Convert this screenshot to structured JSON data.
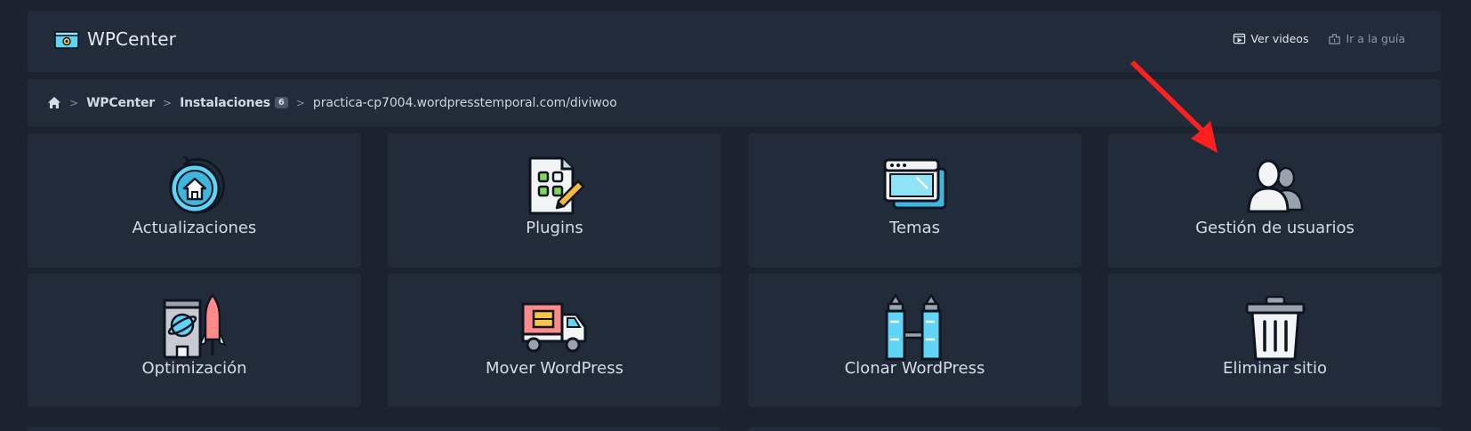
{
  "header": {
    "app_name": "WPCenter",
    "links": [
      {
        "label": "Ver videos",
        "icon": "video-icon"
      },
      {
        "label": "Ir a la guía",
        "icon": "guide-icon"
      }
    ]
  },
  "breadcrumb": {
    "home_icon": "home-icon",
    "items": [
      {
        "label": "WPCenter"
      },
      {
        "label": "Instalaciones",
        "badge": "6"
      },
      {
        "label": "practica-cp7004.wordpresstemporal.com/diviwoo"
      }
    ]
  },
  "cards": [
    {
      "label": "Actualizaciones",
      "icon": "update-house-icon"
    },
    {
      "label": "Plugins",
      "icon": "plugin-edit-icon"
    },
    {
      "label": "Temas",
      "icon": "theme-windows-icon"
    },
    {
      "label": "Gestión de usuarios",
      "icon": "users-icon"
    },
    {
      "label": "Optimización",
      "icon": "optimization-rocket-icon"
    },
    {
      "label": "Mover WordPress",
      "icon": "moving-truck-icon"
    },
    {
      "label": "Clonar WordPress",
      "icon": "clone-towers-icon"
    },
    {
      "label": "Eliminar sitio",
      "icon": "trash-icon"
    }
  ],
  "colors": {
    "background": "#1b2330",
    "panel": "#222b3a",
    "accent_cyan": "#5fd4f4",
    "annotation_arrow": "#ff1f1f"
  }
}
